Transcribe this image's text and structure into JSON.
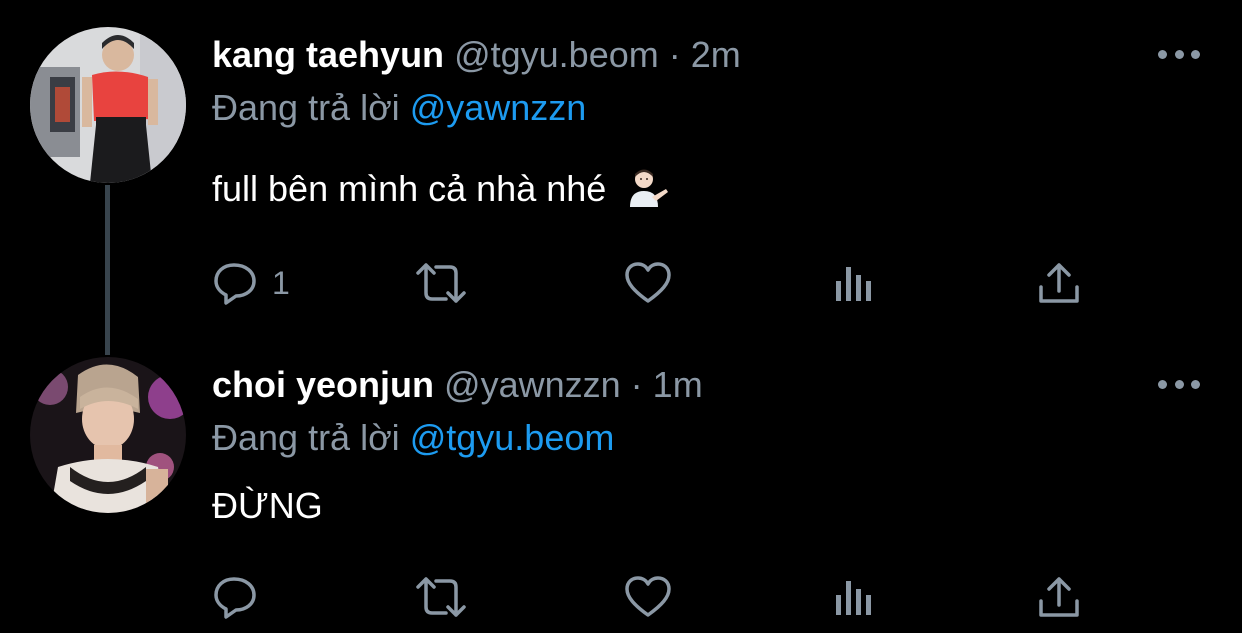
{
  "colors": {
    "background": "#000000",
    "name": "#ffffff",
    "secondary": "#8b98a5",
    "mention": "#1d9bf0",
    "thread_line": "#38444d"
  },
  "tweets": [
    {
      "name": "kang taehyun",
      "handle": "@tgyu.beom",
      "separator": "·",
      "time": "2m",
      "replying_prefix": "Đang trả lời",
      "replying_to": "@yawnzzn",
      "text": "full bên mình cả nhà nhé",
      "emoji": "person-tipping-hand-emoji",
      "reply_count": "1",
      "icons": [
        "reply-icon",
        "retweet-icon",
        "like-icon",
        "views-icon",
        "share-icon",
        "more-icon"
      ]
    },
    {
      "name": "choi yeonjun",
      "handle": "@yawnzzn",
      "separator": "·",
      "time": "1m",
      "replying_prefix": "Đang trả lời",
      "replying_to": "@tgyu.beom",
      "text": "ĐỪNG",
      "reply_count": "",
      "icons": [
        "reply-icon",
        "retweet-icon",
        "like-icon",
        "views-icon",
        "share-icon",
        "more-icon"
      ]
    }
  ]
}
